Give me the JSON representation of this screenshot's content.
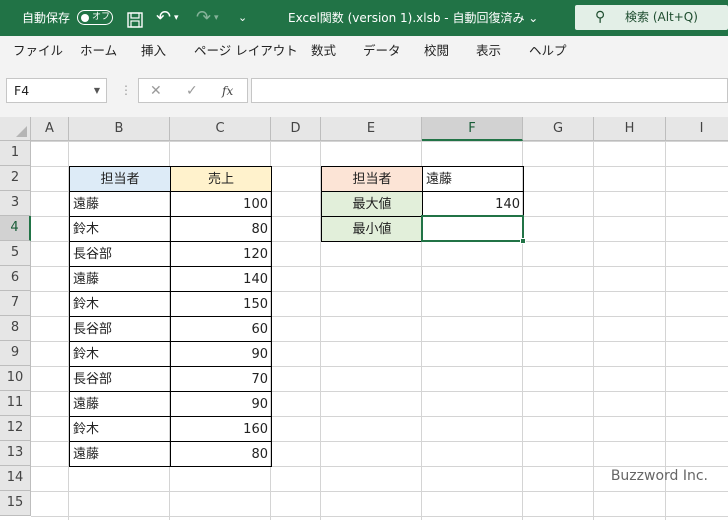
{
  "titlebar": {
    "autosave_label": "自動保存",
    "autosave_state": "オフ",
    "undo_glyph": "↶",
    "redo_glyph": "↷",
    "more_glyph": "⌄",
    "document_title": "Excel関数 (version 1).xlsb  -  自動回復済み  ⌄",
    "search_text": "検索 (Alt+Q)",
    "icons": [
      "save-icon",
      "undo-icon",
      "redo-icon",
      "customize-icon",
      "search-icon"
    ],
    "bar_color": "#217346"
  },
  "menu": [
    "ファイル",
    "ホーム",
    "挿入",
    "ページ レイアウト",
    "数式",
    "データ",
    "校閲",
    "表示",
    "ヘルプ"
  ],
  "formula_bar": {
    "name_box": "F4",
    "cancel_glyph": "✕",
    "enter_glyph": "✓",
    "fx_label": "fx",
    "separator": "⋮",
    "formula": ""
  },
  "sheet": {
    "columns": [
      "A",
      "B",
      "C",
      "D",
      "E",
      "F",
      "G",
      "H",
      "I"
    ],
    "rows": [
      "1",
      "2",
      "3",
      "4",
      "5",
      "6",
      "7",
      "8",
      "9",
      "10",
      "11",
      "12",
      "13",
      "14",
      "15"
    ],
    "selected_column": "F",
    "selected_row": "4",
    "table1": {
      "headers": [
        "担当者",
        "売上"
      ],
      "rows": [
        [
          "遠藤",
          "100"
        ],
        [
          "鈴木",
          "80"
        ],
        [
          "長谷部",
          "120"
        ],
        [
          "遠藤",
          "140"
        ],
        [
          "鈴木",
          "150"
        ],
        [
          "長谷部",
          "60"
        ],
        [
          "鈴木",
          "90"
        ],
        [
          "長谷部",
          "70"
        ],
        [
          "遠藤",
          "90"
        ],
        [
          "鈴木",
          "160"
        ],
        [
          "遠藤",
          "80"
        ]
      ]
    },
    "table2": {
      "criteria_label": "担当者",
      "criteria_value": "遠藤",
      "max_label": "最大値",
      "max_value": "140",
      "min_label": "最小値",
      "min_value": ""
    },
    "watermark": "Buzzword Inc."
  }
}
